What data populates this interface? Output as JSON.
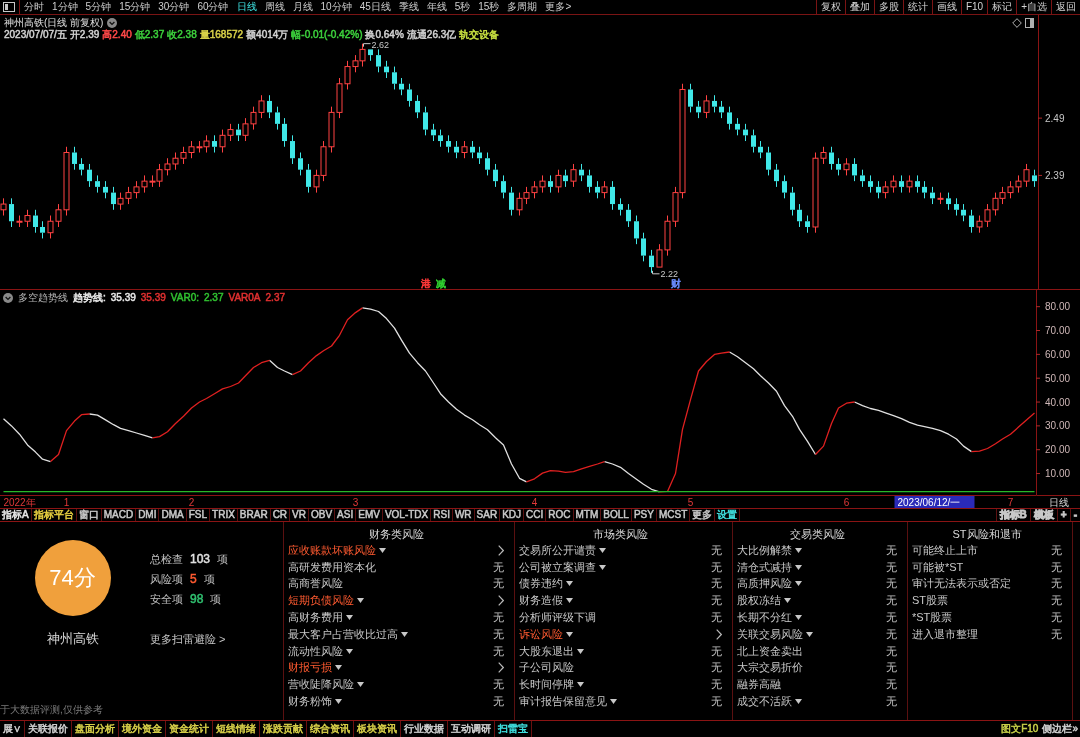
{
  "toolbar": {
    "periods": [
      {
        "label": "分时",
        "selected": false
      },
      {
        "label": "1分钟",
        "selected": false
      },
      {
        "label": "5分钟",
        "selected": false
      },
      {
        "label": "15分钟",
        "selected": false
      },
      {
        "label": "30分钟",
        "selected": false
      },
      {
        "label": "60分钟",
        "selected": false
      },
      {
        "label": "日线",
        "selected": true
      },
      {
        "label": "周线",
        "selected": false
      },
      {
        "label": "月线",
        "selected": false
      },
      {
        "label": "10分钟",
        "selected": false
      },
      {
        "label": "45日线",
        "selected": false
      },
      {
        "label": "季线",
        "selected": false
      },
      {
        "label": "年线",
        "selected": false
      },
      {
        "label": "5秒",
        "selected": false
      },
      {
        "label": "15秒",
        "selected": false
      },
      {
        "label": "多周期",
        "selected": false
      },
      {
        "label": "更多>",
        "selected": false
      }
    ],
    "actions": [
      "复权",
      "叠加",
      "多股",
      "统计",
      "画线",
      "F10",
      "标记",
      "+自选",
      "返回"
    ]
  },
  "main_chart": {
    "title": "神州高铁(日线 前复权)",
    "quote": [
      {
        "text": "2023/07/07/五",
        "color": "#d0d0d0"
      },
      {
        "text": "开2.39",
        "color": "#d0d0d0"
      },
      {
        "text": "高2.40",
        "color": "#ff4848"
      },
      {
        "text": "低2.37",
        "color": "#3cd03c"
      },
      {
        "text": "收2.38",
        "color": "#3cd03c"
      },
      {
        "text": "量168572",
        "color": "#d8d048"
      },
      {
        "text": "额4014万",
        "color": "#d0d0d0"
      },
      {
        "text": "幅-0.01(-0.42%)",
        "color": "#3cd03c"
      },
      {
        "text": "换0.64%",
        "color": "#d0d0d0"
      },
      {
        "text": "流通26.3亿",
        "color": "#d0d0d0"
      },
      {
        "text": "轨交设备",
        "color": "#c8e040"
      }
    ],
    "events": [
      {
        "text": "港",
        "color": "#ff3838"
      },
      {
        "text": "减",
        "color": "#30d030"
      },
      {
        "text": "财",
        "color": "#6a8cff"
      }
    ],
    "chart_data": [
      {
        "type": "candlestick",
        "ylim": [
          2.19,
          2.67
        ],
        "yticks": [
          2.39,
          2.49
        ],
        "categories": [
          null,
          null,
          null,
          null,
          null,
          null,
          null,
          null,
          null,
          null,
          null,
          null,
          null,
          null,
          null,
          null,
          null,
          null,
          null,
          null,
          null,
          null,
          null,
          null,
          null,
          null,
          null,
          null,
          null,
          null,
          null,
          null,
          null,
          null,
          null,
          null,
          null,
          null,
          null,
          null,
          null,
          null,
          null,
          null,
          null,
          null,
          null,
          null,
          null,
          null,
          null,
          null,
          null,
          null,
          null,
          null,
          null,
          null,
          null,
          null,
          null,
          null,
          null,
          null,
          null,
          null,
          null,
          null,
          null,
          null,
          null,
          null,
          null,
          null,
          null,
          null,
          null,
          null,
          null,
          null,
          null,
          null,
          null,
          null,
          null,
          null,
          null,
          null,
          null,
          null,
          null,
          null,
          null,
          null,
          null,
          null,
          null,
          null,
          null,
          null,
          null,
          null,
          null,
          null,
          null,
          null,
          null,
          null,
          null,
          null,
          null,
          null,
          null,
          null,
          null,
          null,
          null,
          null,
          null,
          null,
          null,
          null,
          null,
          null,
          null,
          null,
          null,
          null,
          null,
          null,
          null,
          null,
          null
        ],
        "ohlc": [
          [
            2.33,
            2.35,
            2.32,
            2.34
          ],
          [
            2.34,
            2.35,
            2.3,
            2.31
          ],
          [
            2.31,
            2.32,
            2.3,
            2.31
          ],
          [
            2.31,
            2.33,
            2.3,
            2.32
          ],
          [
            2.32,
            2.33,
            2.29,
            2.3
          ],
          [
            2.3,
            2.31,
            2.28,
            2.29
          ],
          [
            2.29,
            2.32,
            2.28,
            2.31
          ],
          [
            2.31,
            2.34,
            2.3,
            2.33
          ],
          [
            2.33,
            2.44,
            2.32,
            2.43
          ],
          [
            2.43,
            2.44,
            2.4,
            2.41
          ],
          [
            2.41,
            2.42,
            2.39,
            2.4
          ],
          [
            2.4,
            2.41,
            2.37,
            2.38
          ],
          [
            2.38,
            2.39,
            2.36,
            2.37
          ],
          [
            2.37,
            2.38,
            2.35,
            2.36
          ],
          [
            2.36,
            2.37,
            2.33,
            2.34
          ],
          [
            2.34,
            2.36,
            2.33,
            2.35
          ],
          [
            2.35,
            2.37,
            2.34,
            2.36
          ],
          [
            2.36,
            2.38,
            2.35,
            2.37
          ],
          [
            2.37,
            2.39,
            2.36,
            2.38
          ],
          [
            2.38,
            2.39,
            2.37,
            2.38
          ],
          [
            2.38,
            2.41,
            2.37,
            2.4
          ],
          [
            2.4,
            2.42,
            2.39,
            2.41
          ],
          [
            2.41,
            2.43,
            2.4,
            2.42
          ],
          [
            2.42,
            2.44,
            2.41,
            2.43
          ],
          [
            2.43,
            2.45,
            2.42,
            2.44
          ],
          [
            2.44,
            2.45,
            2.43,
            2.44
          ],
          [
            2.44,
            2.46,
            2.43,
            2.45
          ],
          [
            2.45,
            2.46,
            2.43,
            2.44
          ],
          [
            2.44,
            2.47,
            2.43,
            2.46
          ],
          [
            2.46,
            2.48,
            2.45,
            2.47
          ],
          [
            2.47,
            2.48,
            2.45,
            2.46
          ],
          [
            2.46,
            2.49,
            2.45,
            2.48
          ],
          [
            2.48,
            2.51,
            2.47,
            2.5
          ],
          [
            2.5,
            2.53,
            2.49,
            2.52
          ],
          [
            2.52,
            2.53,
            2.49,
            2.5
          ],
          [
            2.5,
            2.51,
            2.47,
            2.48
          ],
          [
            2.48,
            2.49,
            2.44,
            2.45
          ],
          [
            2.45,
            2.46,
            2.41,
            2.42
          ],
          [
            2.42,
            2.43,
            2.39,
            2.4
          ],
          [
            2.4,
            2.41,
            2.36,
            2.37
          ],
          [
            2.37,
            2.4,
            2.36,
            2.39
          ],
          [
            2.39,
            2.45,
            2.38,
            2.44
          ],
          [
            2.44,
            2.51,
            2.43,
            2.5
          ],
          [
            2.5,
            2.56,
            2.49,
            2.55
          ],
          [
            2.55,
            2.59,
            2.54,
            2.58
          ],
          [
            2.58,
            2.6,
            2.57,
            2.59
          ],
          [
            2.59,
            2.62,
            2.58,
            2.61
          ],
          [
            2.61,
            2.61,
            2.59,
            2.6
          ],
          [
            2.6,
            2.61,
            2.57,
            2.58
          ],
          [
            2.58,
            2.59,
            2.56,
            2.57
          ],
          [
            2.57,
            2.58,
            2.54,
            2.55
          ],
          [
            2.55,
            2.56,
            2.53,
            2.54
          ],
          [
            2.54,
            2.55,
            2.51,
            2.52
          ],
          [
            2.52,
            2.53,
            2.49,
            2.5
          ],
          [
            2.5,
            2.51,
            2.46,
            2.47
          ],
          [
            2.47,
            2.48,
            2.45,
            2.46
          ],
          [
            2.46,
            2.47,
            2.44,
            2.45
          ],
          [
            2.45,
            2.46,
            2.43,
            2.44
          ],
          [
            2.44,
            2.45,
            2.42,
            2.43
          ],
          [
            2.43,
            2.45,
            2.42,
            2.44
          ],
          [
            2.44,
            2.45,
            2.42,
            2.43
          ],
          [
            2.43,
            2.44,
            2.41,
            2.42
          ],
          [
            2.42,
            2.43,
            2.39,
            2.4
          ],
          [
            2.4,
            2.41,
            2.37,
            2.38
          ],
          [
            2.38,
            2.39,
            2.35,
            2.36
          ],
          [
            2.36,
            2.37,
            2.32,
            2.33
          ],
          [
            2.33,
            2.36,
            2.32,
            2.35
          ],
          [
            2.35,
            2.37,
            2.34,
            2.36
          ],
          [
            2.36,
            2.38,
            2.35,
            2.37
          ],
          [
            2.37,
            2.39,
            2.36,
            2.38
          ],
          [
            2.38,
            2.39,
            2.36,
            2.37
          ],
          [
            2.37,
            2.4,
            2.36,
            2.39
          ],
          [
            2.39,
            2.4,
            2.37,
            2.38
          ],
          [
            2.38,
            2.41,
            2.37,
            2.4
          ],
          [
            2.4,
            2.41,
            2.38,
            2.39
          ],
          [
            2.39,
            2.4,
            2.36,
            2.37
          ],
          [
            2.37,
            2.38,
            2.35,
            2.36
          ],
          [
            2.36,
            2.38,
            2.35,
            2.37
          ],
          [
            2.37,
            2.38,
            2.33,
            2.34
          ],
          [
            2.34,
            2.35,
            2.32,
            2.33
          ],
          [
            2.33,
            2.34,
            2.3,
            2.31
          ],
          [
            2.31,
            2.32,
            2.27,
            2.28
          ],
          [
            2.28,
            2.29,
            2.24,
            2.25
          ],
          [
            2.25,
            2.26,
            2.22,
            2.23
          ],
          [
            2.23,
            2.27,
            2.23,
            2.26
          ],
          [
            2.26,
            2.32,
            2.25,
            2.31
          ],
          [
            2.31,
            2.37,
            2.3,
            2.36
          ],
          [
            2.36,
            2.55,
            2.35,
            2.54
          ],
          [
            2.54,
            2.55,
            2.5,
            2.51
          ],
          [
            2.51,
            2.52,
            2.49,
            2.5
          ],
          [
            2.5,
            2.53,
            2.49,
            2.52
          ],
          [
            2.52,
            2.53,
            2.5,
            2.51
          ],
          [
            2.51,
            2.52,
            2.49,
            2.5
          ],
          [
            2.5,
            2.51,
            2.47,
            2.48
          ],
          [
            2.48,
            2.49,
            2.46,
            2.47
          ],
          [
            2.47,
            2.48,
            2.45,
            2.46
          ],
          [
            2.46,
            2.47,
            2.43,
            2.44
          ],
          [
            2.44,
            2.45,
            2.42,
            2.43
          ],
          [
            2.43,
            2.44,
            2.39,
            2.4
          ],
          [
            2.4,
            2.41,
            2.37,
            2.38
          ],
          [
            2.38,
            2.39,
            2.35,
            2.36
          ],
          [
            2.36,
            2.37,
            2.32,
            2.33
          ],
          [
            2.33,
            2.34,
            2.3,
            2.31
          ],
          [
            2.31,
            2.32,
            2.29,
            2.3
          ],
          [
            2.3,
            2.43,
            2.29,
            2.42
          ],
          [
            2.42,
            2.44,
            2.41,
            2.43
          ],
          [
            2.43,
            2.44,
            2.4,
            2.41
          ],
          [
            2.41,
            2.42,
            2.39,
            2.4
          ],
          [
            2.4,
            2.42,
            2.39,
            2.41
          ],
          [
            2.41,
            2.42,
            2.38,
            2.39
          ],
          [
            2.39,
            2.4,
            2.37,
            2.38
          ],
          [
            2.38,
            2.39,
            2.36,
            2.37
          ],
          [
            2.37,
            2.38,
            2.35,
            2.36
          ],
          [
            2.36,
            2.38,
            2.35,
            2.37
          ],
          [
            2.37,
            2.39,
            2.36,
            2.38
          ],
          [
            2.38,
            2.39,
            2.36,
            2.37
          ],
          [
            2.37,
            2.39,
            2.36,
            2.38
          ],
          [
            2.38,
            2.39,
            2.36,
            2.37
          ],
          [
            2.37,
            2.38,
            2.35,
            2.36
          ],
          [
            2.36,
            2.37,
            2.34,
            2.35
          ],
          [
            2.35,
            2.36,
            2.34,
            2.35
          ],
          [
            2.35,
            2.36,
            2.33,
            2.34
          ],
          [
            2.34,
            2.35,
            2.32,
            2.33
          ],
          [
            2.33,
            2.34,
            2.31,
            2.32
          ],
          [
            2.32,
            2.33,
            2.29,
            2.3
          ],
          [
            2.3,
            2.32,
            2.29,
            2.31
          ],
          [
            2.31,
            2.34,
            2.3,
            2.33
          ],
          [
            2.33,
            2.36,
            2.32,
            2.35
          ],
          [
            2.35,
            2.37,
            2.34,
            2.36
          ],
          [
            2.36,
            2.38,
            2.35,
            2.37
          ],
          [
            2.37,
            2.39,
            2.36,
            2.38
          ],
          [
            2.38,
            2.41,
            2.37,
            2.4
          ],
          [
            2.39,
            2.4,
            2.37,
            2.38
          ]
        ],
        "annotations": [
          "2.62",
          "2.22"
        ]
      }
    ]
  },
  "indicator": {
    "title": "多空趋势线",
    "readings": [
      {
        "label": "趋势线:",
        "value": "35.39",
        "color": "#e8e8e8"
      },
      {
        "value": "35.39",
        "color": "#e03030"
      },
      {
        "label": "VAR0:",
        "value": "2.37",
        "color": "#30c030"
      },
      {
        "label": "VAR0A",
        "value": "2.37",
        "color": "#e03030"
      }
    ],
    "axis_label": "日线",
    "chart_data": [
      {
        "type": "line",
        "ylim": [
          1,
          87
        ],
        "yticks": [
          {
            "value": 80,
            "label": "80.00"
          },
          {
            "value": 70,
            "label": "70.00"
          },
          {
            "value": 60,
            "label": "60.00"
          },
          {
            "value": 50,
            "label": "50.00"
          },
          {
            "value": 40,
            "label": "40.00"
          },
          {
            "value": 30,
            "label": "30.00"
          },
          {
            "value": 20,
            "label": "20.00"
          },
          {
            "value": 10,
            "label": "10.00"
          }
        ],
        "categories": [
          null,
          null,
          "2022年",
          null,
          null,
          null,
          null,
          null,
          "1",
          null,
          null,
          null,
          null,
          null,
          null,
          null,
          null,
          null,
          null,
          null,
          null,
          null,
          null,
          null,
          "2",
          null,
          null,
          null,
          null,
          null,
          null,
          null,
          null,
          null,
          null,
          null,
          null,
          null,
          null,
          null,
          null,
          null,
          null,
          null,
          null,
          "3",
          null,
          null,
          null,
          null,
          null,
          null,
          null,
          null,
          null,
          null,
          null,
          null,
          null,
          null,
          null,
          null,
          null,
          null,
          null,
          null,
          null,
          null,
          "4",
          null,
          null,
          null,
          null,
          null,
          null,
          null,
          null,
          null,
          null,
          null,
          null,
          null,
          null,
          null,
          null,
          null,
          null,
          null,
          "5",
          null,
          null,
          null,
          null,
          null,
          null,
          null,
          null,
          null,
          null,
          null,
          null,
          null,
          null,
          null,
          null,
          null,
          null,
          null,
          "6",
          null,
          null,
          null,
          null,
          null,
          null,
          null,
          null,
          null,
          null,
          null,
          null,
          null,
          null,
          null,
          null,
          null,
          null,
          null,
          null,
          "7",
          null,
          null,
          null
        ],
        "annotations": [
          "2023/06/12/一"
        ],
        "series": [
          {
            "color": "#e0e0e0",
            "values": [
              33,
              30,
              26.5,
              22,
              19,
              16,
              15,
              null,
              null,
              null,
              null,
              35,
              34.5,
              32.5,
              30.5,
              29,
              28,
              27,
              26,
              25,
              null,
              null,
              null,
              null,
              null,
              null,
              null,
              null,
              null,
              null,
              null,
              null,
              null,
              null,
              57.5,
              54.5,
              53,
              51.5,
              null,
              null,
              null,
              null,
              null,
              null,
              null,
              null,
              79.5,
              79,
              78,
              75,
              71,
              66,
              60.5,
              56.5,
              53,
              48,
              43.5,
              40,
              37,
              34.5,
              32.6,
              30.5,
              28.4,
              25,
              22,
              14,
              8,
              6.5,
              null,
              null,
              null,
              null,
              null,
              null,
              null,
              null,
              null,
              15,
              14,
              12.6,
              10,
              7.6,
              5.5,
              3.4,
              2.3,
              null,
              null,
              null,
              null,
              null,
              null,
              null,
              null,
              61,
              59,
              56.5,
              54,
              51,
              48,
              44.5,
              38.5,
              34,
              28.5,
              23.5,
              18,
              null,
              null,
              null,
              null,
              40,
              38.5,
              37.3,
              36.5,
              35.5,
              34.3,
              33,
              31.5,
              30.3,
              29.7,
              29,
              28,
              26.5,
              24.5,
              21.5,
              19.2,
              null,
              null,
              null,
              null,
              null,
              null,
              null,
              null
            ]
          },
          {
            "color": "#e02020",
            "values": [
              null,
              null,
              null,
              null,
              null,
              null,
              15,
              18,
              28,
              32,
              34.7,
              35,
              null,
              null,
              null,
              null,
              null,
              null,
              null,
              25,
              25.5,
              27.5,
              31,
              34,
              37.5,
              40,
              41.5,
              43.5,
              45.5,
              46.5,
              48,
              51,
              54.5,
              56.5,
              57.5,
              null,
              null,
              51.5,
              53,
              56.5,
              59.5,
              61.5,
              63.5,
              68,
              74.5,
              77.5,
              79.5,
              null,
              null,
              null,
              null,
              null,
              null,
              null,
              null,
              null,
              null,
              null,
              null,
              null,
              null,
              null,
              null,
              null,
              null,
              null,
              null,
              6.5,
              7.8,
              10.2,
              11.2,
              11,
              10.5,
              10.8,
              12,
              13,
              14,
              15,
              null,
              null,
              null,
              null,
              null,
              null,
              2.3,
              2.5,
              10,
              28.5,
              41,
              53,
              57,
              60,
              60.5,
              61,
              null,
              null,
              null,
              null,
              null,
              null,
              null,
              null,
              null,
              null,
              18,
              21.5,
              31,
              37.5,
              39.5,
              40,
              null,
              null,
              null,
              null,
              null,
              null,
              null,
              null,
              null,
              null,
              null,
              null,
              null,
              null,
              19.2,
              19.4,
              20.5,
              22.5,
              24.5,
              26.5,
              29.5,
              32.5,
              35.4
            ]
          },
          {
            "color": "#28b828",
            "values": [
              2.4,
              2.4,
              2.4,
              2.4,
              2.4,
              2.4,
              2.4,
              2.4,
              2.4,
              2.4,
              2.4,
              2.4,
              2.4,
              2.4,
              2.4,
              2.4,
              2.4,
              2.4,
              2.4,
              2.4,
              2.4,
              2.4,
              2.4,
              2.4,
              2.4,
              2.4,
              2.4,
              2.4,
              2.4,
              2.4,
              2.4,
              2.4,
              2.4,
              2.4,
              2.4,
              2.4,
              2.4,
              2.4,
              2.4,
              2.4,
              2.4,
              2.4,
              2.4,
              2.4,
              2.4,
              2.4,
              2.4,
              2.4,
              2.4,
              2.4,
              2.4,
              2.4,
              2.4,
              2.4,
              2.4,
              2.4,
              2.4,
              2.4,
              2.4,
              2.4,
              2.4,
              2.4,
              2.4,
              2.4,
              2.4,
              2.4,
              2.4,
              2.4,
              2.4,
              2.4,
              2.4,
              2.4,
              2.4,
              2.4,
              2.4,
              2.4,
              2.4,
              2.4,
              2.4,
              2.4,
              2.4,
              2.4,
              2.4,
              2.4,
              2.4,
              2.4,
              2.4,
              2.4,
              2.4,
              2.4,
              2.4,
              2.4,
              2.4,
              2.4,
              2.4,
              2.4,
              2.4,
              2.4,
              2.4,
              2.4,
              2.4,
              2.4,
              2.4,
              2.4,
              2.4,
              2.4,
              2.4,
              2.4,
              2.4,
              2.4,
              2.4,
              2.4,
              2.4,
              2.4,
              2.4,
              2.4,
              2.4,
              2.4,
              2.4,
              2.4,
              2.4,
              2.4,
              2.4,
              2.4,
              2.4,
              2.4,
              2.4,
              2.4,
              2.4,
              2.4,
              2.4,
              2.4,
              2.4
            ]
          }
        ]
      }
    ]
  },
  "indicator_tabs": {
    "left": [
      {
        "label": "指标A",
        "color": "#e8e8e8"
      },
      {
        "label": "指标平台",
        "color": "#e8d040"
      },
      {
        "label": "窗口",
        "color": "#c8c8c8"
      },
      {
        "label": "MACD",
        "color": "#c8c8c8"
      },
      {
        "label": "DMI",
        "color": "#c8c8c8"
      },
      {
        "label": "DMA",
        "color": "#c8c8c8"
      },
      {
        "label": "FSL",
        "color": "#c8c8c8"
      },
      {
        "label": "TRIX",
        "color": "#c8c8c8"
      },
      {
        "label": "BRAR",
        "color": "#c8c8c8"
      },
      {
        "label": "CR",
        "color": "#c8c8c8"
      },
      {
        "label": "VR",
        "color": "#c8c8c8"
      },
      {
        "label": "OBV",
        "color": "#c8c8c8"
      },
      {
        "label": "ASI",
        "color": "#c8c8c8"
      },
      {
        "label": "EMV",
        "color": "#c8c8c8"
      },
      {
        "label": "VOL-TDX",
        "color": "#c8c8c8"
      },
      {
        "label": "RSI",
        "color": "#c8c8c8"
      },
      {
        "label": "WR",
        "color": "#c8c8c8"
      },
      {
        "label": "SAR",
        "color": "#c8c8c8"
      },
      {
        "label": "KDJ",
        "color": "#c8c8c8"
      },
      {
        "label": "CCI",
        "color": "#c8c8c8"
      },
      {
        "label": "ROC",
        "color": "#c8c8c8"
      },
      {
        "label": "MTM",
        "color": "#c8c8c8"
      },
      {
        "label": "BOLL",
        "color": "#c8c8c8"
      },
      {
        "label": "PSY",
        "color": "#c8c8c8"
      },
      {
        "label": "MCST",
        "color": "#c8c8c8"
      },
      {
        "label": "更多",
        "color": "#c8c8c8"
      },
      {
        "label": "设置",
        "color": "#40dede"
      }
    ],
    "right": [
      {
        "label": "指标B",
        "color": "#c8c8c8"
      },
      {
        "label": "模板",
        "color": "#c8c8c8"
      },
      {
        "label": "+",
        "color": "#c8c8c8"
      },
      {
        "label": "-",
        "color": "#c8c8c8"
      }
    ]
  },
  "risk_scan": {
    "score": "74分",
    "stock": "神州高铁",
    "stats": [
      {
        "label": "总检查",
        "value": "103",
        "unit": "项",
        "color": "#e0e0e0"
      },
      {
        "label": "风险项",
        "value": "5",
        "unit": "项",
        "color": "#ff5a30"
      },
      {
        "label": "安全项",
        "value": "98",
        "unit": "项",
        "color": "#30c070"
      }
    ],
    "more_link": "更多扫雷避险 >",
    "note": "于大数据评测,仅供参考",
    "categories": [
      {
        "title": "财务类风险",
        "items": [
          {
            "label": "应收账款坏账风险",
            "risk": true,
            "dropdown": true
          },
          {
            "label": "高研发费用资本化",
            "risk": false,
            "dropdown": false,
            "value": "无"
          },
          {
            "label": "高商誉风险",
            "risk": false,
            "dropdown": false,
            "value": "无"
          },
          {
            "label": "短期负债风险",
            "risk": true,
            "dropdown": true
          },
          {
            "label": "高财务费用",
            "risk": false,
            "dropdown": true,
            "value": "无"
          },
          {
            "label": "最大客户占营收比过高",
            "risk": false,
            "dropdown": true,
            "value": "无"
          },
          {
            "label": "流动性风险",
            "risk": false,
            "dropdown": true,
            "value": "无"
          },
          {
            "label": "财报亏损",
            "risk": true,
            "dropdown": true
          },
          {
            "label": "营收陡降风险",
            "risk": false,
            "dropdown": true,
            "value": "无"
          },
          {
            "label": "财务粉饰",
            "risk": false,
            "dropdown": true,
            "value": "无"
          }
        ]
      },
      {
        "title": "市场类风险",
        "items": [
          {
            "label": "交易所公开谴责",
            "risk": false,
            "dropdown": true,
            "value": "无"
          },
          {
            "label": "公司被立案调查",
            "risk": false,
            "dropdown": true,
            "value": "无"
          },
          {
            "label": "债券违约",
            "risk": false,
            "dropdown": true,
            "value": "无"
          },
          {
            "label": "财务造假",
            "risk": false,
            "dropdown": true,
            "value": "无"
          },
          {
            "label": "分析师评级下调",
            "risk": false,
            "dropdown": false,
            "value": "无"
          },
          {
            "label": "诉讼风险",
            "risk": true,
            "dropdown": true
          },
          {
            "label": "大股东退出",
            "risk": false,
            "dropdown": true,
            "value": "无"
          },
          {
            "label": "子公司风险",
            "risk": false,
            "dropdown": false,
            "value": "无"
          },
          {
            "label": "长时间停牌",
            "risk": false,
            "dropdown": true,
            "value": "无"
          },
          {
            "label": "审计报告保留意见",
            "risk": false,
            "dropdown": true,
            "value": "无"
          }
        ]
      },
      {
        "title": "交易类风险",
        "items": [
          {
            "label": "大比例解禁",
            "risk": false,
            "dropdown": true,
            "value": "无"
          },
          {
            "label": "清仓式减持",
            "risk": false,
            "dropdown": true,
            "value": "无"
          },
          {
            "label": "高质押风险",
            "risk": false,
            "dropdown": true,
            "value": "无"
          },
          {
            "label": "股权冻结",
            "risk": false,
            "dropdown": true,
            "value": "无"
          },
          {
            "label": "长期不分红",
            "risk": false,
            "dropdown": true,
            "value": "无"
          },
          {
            "label": "关联交易风险",
            "risk": false,
            "dropdown": true,
            "value": "无"
          },
          {
            "label": "北上资金卖出",
            "risk": false,
            "dropdown": false,
            "value": "无"
          },
          {
            "label": "大宗交易折价",
            "risk": false,
            "dropdown": false,
            "value": "无"
          },
          {
            "label": "融券高融",
            "risk": false,
            "dropdown": false,
            "value": "无"
          },
          {
            "label": "成交不活跃",
            "risk": false,
            "dropdown": true,
            "value": "无"
          }
        ]
      },
      {
        "title": "ST风险和退市",
        "items": [
          {
            "label": "可能终止上市",
            "risk": false,
            "dropdown": false,
            "value": "无"
          },
          {
            "label": "可能被*ST",
            "risk": false,
            "dropdown": false,
            "value": "无"
          },
          {
            "label": "审计无法表示或否定",
            "risk": false,
            "dropdown": false,
            "value": "无"
          },
          {
            "label": "ST股票",
            "risk": false,
            "dropdown": false,
            "value": "无"
          },
          {
            "label": "*ST股票",
            "risk": false,
            "dropdown": false,
            "value": "无"
          },
          {
            "label": "进入退市整理",
            "risk": false,
            "dropdown": false,
            "value": "无"
          }
        ]
      }
    ]
  },
  "bottom_tabs": {
    "tabs": [
      {
        "label": "展∨",
        "selected": false,
        "color": "#d0d0d0"
      },
      {
        "label": "关联报价",
        "selected": false,
        "color": "#d0d0d0"
      },
      {
        "label": "盘面分析",
        "selected": false,
        "color": "#d8d048"
      },
      {
        "label": "境外资金",
        "selected": false,
        "color": "#d8d048"
      },
      {
        "label": "资金统计",
        "selected": false,
        "color": "#d8d048"
      },
      {
        "label": "短线情绪",
        "selected": false,
        "color": "#d8d048"
      },
      {
        "label": "涨跌贡献",
        "selected": false,
        "color": "#d8d048"
      },
      {
        "label": "综合资讯",
        "selected": false,
        "color": "#d8d048"
      },
      {
        "label": "板块资讯",
        "selected": false,
        "color": "#d8d048"
      },
      {
        "label": "行业数据",
        "selected": false,
        "color": "#d0d0d0"
      },
      {
        "label": "互动调研",
        "selected": false,
        "color": "#d0d0d0"
      },
      {
        "label": "扫雷宝",
        "selected": true
      }
    ],
    "links": [
      {
        "label": "图文F10",
        "color": "#c8d048"
      },
      {
        "label": "侧边栏»",
        "color": "#d0d0d0"
      }
    ]
  }
}
